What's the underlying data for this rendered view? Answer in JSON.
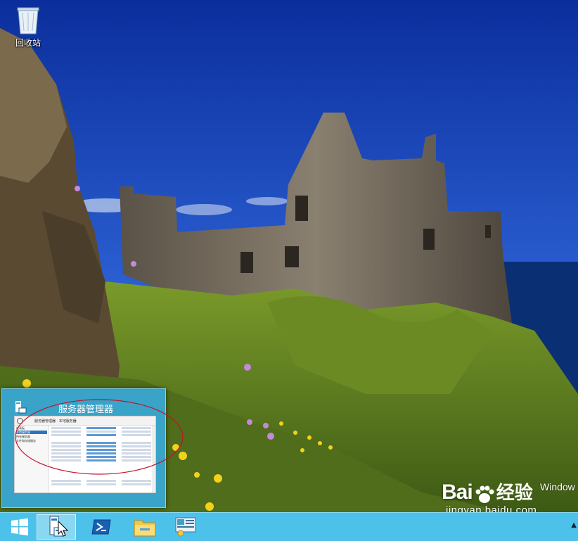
{
  "desktop": {
    "icons": [
      {
        "name": "recycle-bin",
        "label": "回收站",
        "icon": "recycle-bin-icon"
      }
    ],
    "watermark_windows": "Window",
    "watermark_baidu_brand_left": "Bai",
    "watermark_baidu_brand_right": "经验",
    "watermark_baidu_url": "jingyan.baidu.com"
  },
  "thumbnail_preview": {
    "title": "服务器管理器",
    "window_breadcrumb": "服务器管理器 · 本地服务器",
    "sidebar_items": [
      "仪表板",
      "本地服务器",
      "所有服务器",
      "文件和存储服务"
    ]
  },
  "taskbar": {
    "buttons": [
      {
        "name": "start-button",
        "icon": "windows-logo-icon"
      },
      {
        "name": "server-manager-button",
        "icon": "server-manager-icon",
        "active": true
      },
      {
        "name": "powershell-button",
        "icon": "powershell-icon"
      },
      {
        "name": "file-explorer-button",
        "icon": "folder-icon"
      },
      {
        "name": "control-panel-button",
        "icon": "control-panel-icon"
      }
    ],
    "tray_arrow": "▲"
  },
  "colors": {
    "taskbar": "#4cc2ea",
    "thumbnail_bg": "#3aa3c8",
    "annotation_ellipse": "#c0142a"
  }
}
